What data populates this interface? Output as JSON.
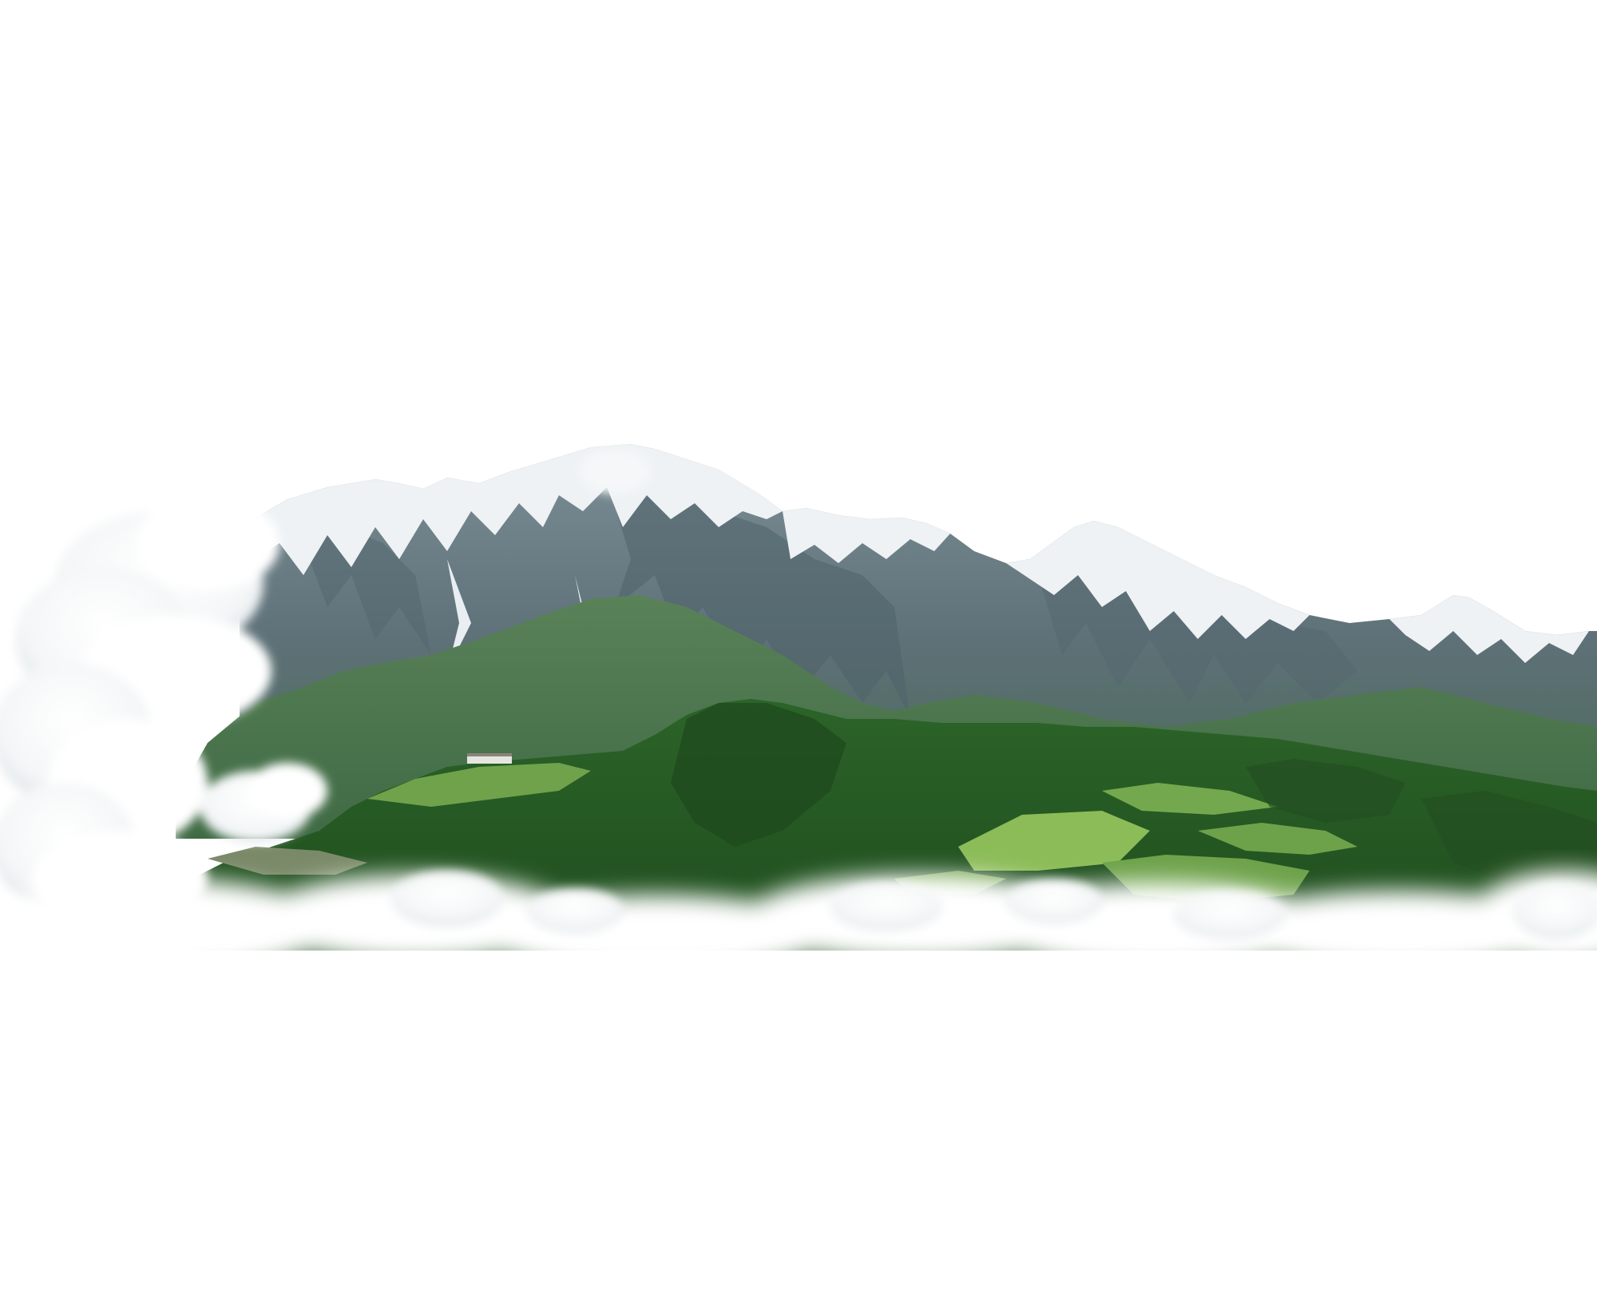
{
  "scene": {
    "subject": "mountain-landscape",
    "background_color": "#ffffff",
    "colors": {
      "far_ridge_rock": "#6b7f86",
      "far_ridge_shadow": "#4d6168",
      "snow": "#f2f5f7",
      "snow_shade": "#cfd8dd",
      "forest_slope": "#4f7a52",
      "forest_dark": "#2f5a33",
      "hill_forest": "#2f6b2c",
      "hill_forest_dark": "#1f4d1f",
      "meadow": "#6ea24a",
      "meadow_light": "#8cbc58",
      "cloud": "#ffffff",
      "cloud_shade": "#e4e9ec"
    }
  }
}
